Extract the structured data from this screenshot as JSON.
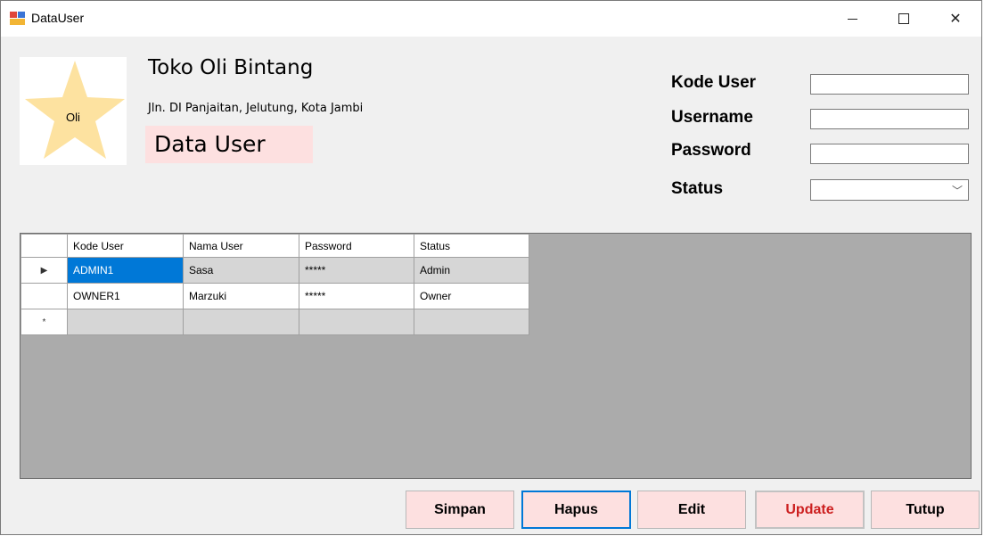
{
  "window": {
    "title": "DataUser"
  },
  "logo": {
    "label": "Oli",
    "star_color": "#fde2a0"
  },
  "header": {
    "store_name": "Toko Oli Bintang",
    "address": "Jln. DI Panjaitan, Jelutung, Kota Jambi",
    "form_title": "Data User"
  },
  "form": {
    "kode_user_label": "Kode User",
    "username_label": "Username",
    "password_label": "Password",
    "status_label": "Status",
    "kode_user_value": "",
    "username_value": "",
    "password_value": "",
    "status_value": ""
  },
  "grid": {
    "columns": [
      "Kode User",
      "Nama User",
      "Password",
      "Status"
    ],
    "rows": [
      {
        "kode_user": "ADMIN1",
        "nama_user": "Sasa",
        "password": "*****",
        "status": "Admin"
      },
      {
        "kode_user": "OWNER1",
        "nama_user": "Marzuki",
        "password": "*****",
        "status": "Owner"
      }
    ],
    "selected_marker": "▶",
    "new_row_marker": "*"
  },
  "buttons": {
    "simpan": "Simpan",
    "hapus": "Hapus",
    "edit": "Edit",
    "update": "Update",
    "tutup": "Tutup"
  },
  "colors": {
    "button_bg": "#fde0e0",
    "selection": "#0078d7",
    "grid_bg": "#ababab",
    "update_text": "#cc1f1f"
  }
}
